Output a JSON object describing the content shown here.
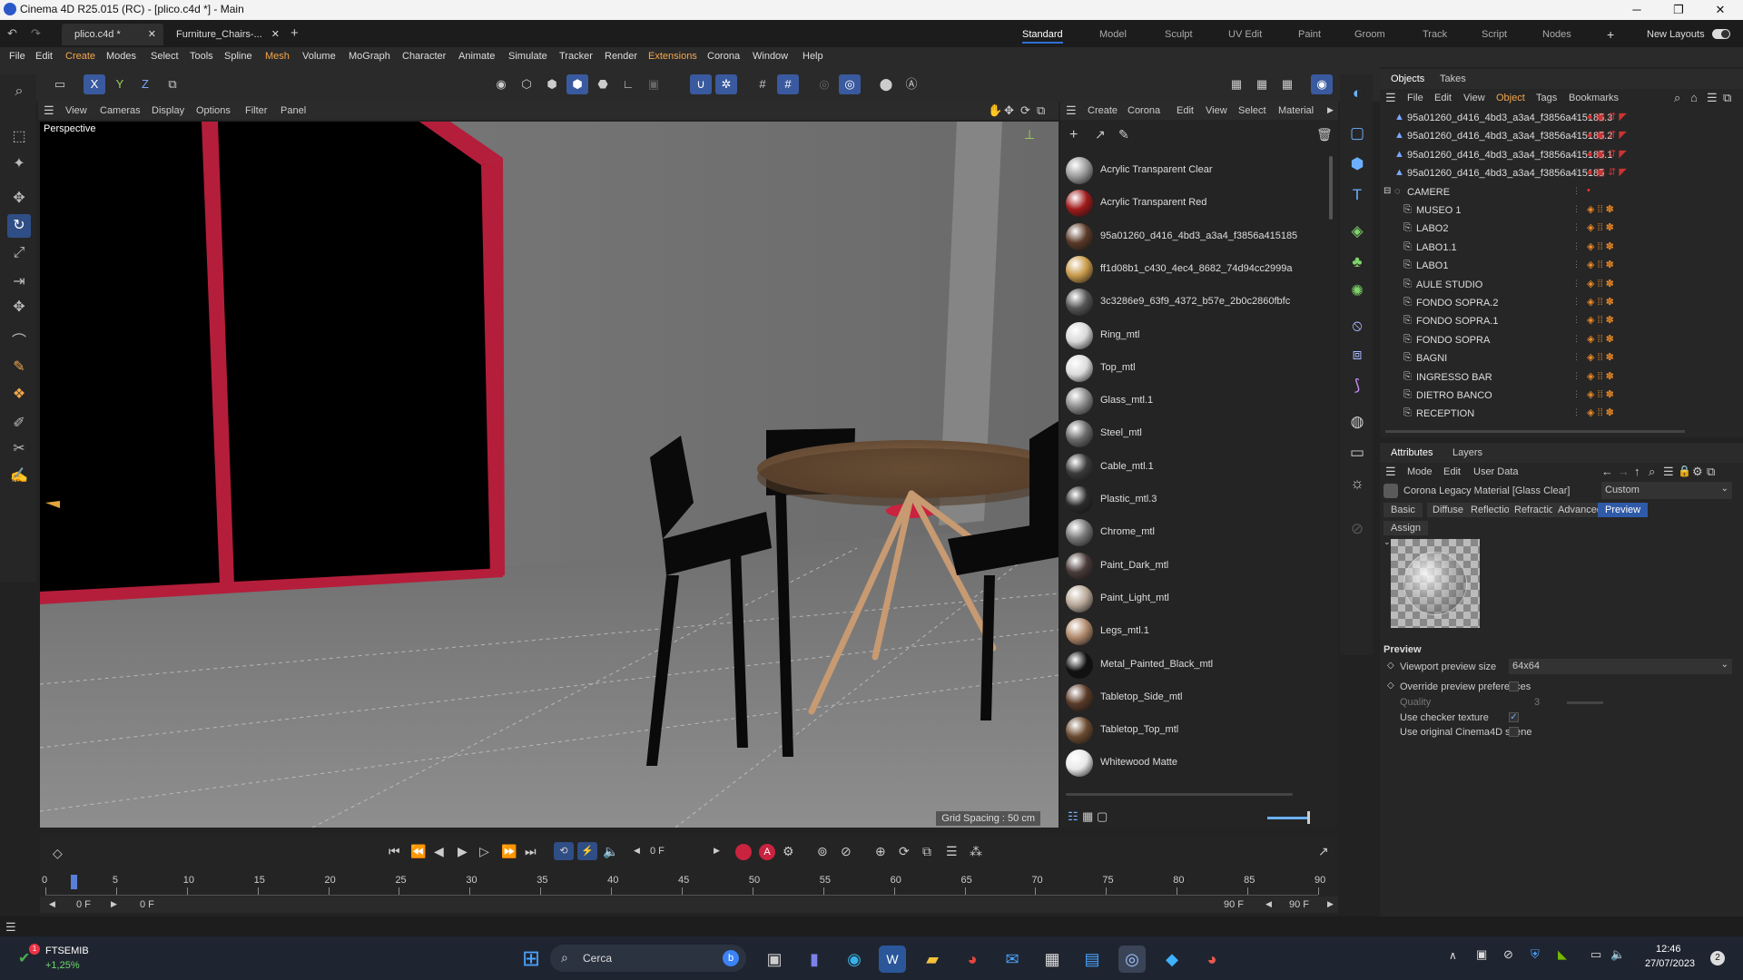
{
  "window": {
    "title": "Cinema 4D R25.015 (RC) - [plico.c4d *] - Main",
    "minimize": "─",
    "maximize": "❐",
    "close": "✕"
  },
  "doc_tabs": [
    {
      "label": "plico.c4d *",
      "close": "✕"
    },
    {
      "label": "Furniture_Chairs-...",
      "close": "✕"
    }
  ],
  "add_tab": "+",
  "layouts": [
    "Standard",
    "Model",
    "Sculpt",
    "UV Edit",
    "Paint",
    "Groom",
    "Track",
    "Script",
    "Nodes"
  ],
  "layouts_add": "+",
  "new_layouts": "New Layouts",
  "menu": [
    "File",
    "Edit",
    "Create",
    "Modes",
    "Select",
    "Tools",
    "Spline",
    "Mesh",
    "Volume",
    "MoGraph",
    "Character",
    "Animate",
    "Simulate",
    "Tracker",
    "Render",
    "Extensions",
    "Corona",
    "Window",
    "Help"
  ],
  "axis_lock": {
    "x": "X",
    "y": "Y",
    "z": "Z"
  },
  "viewport": {
    "menu": [
      "View",
      "Cameras",
      "Display",
      "Options",
      "Filter",
      "Panel"
    ],
    "label": "Perspective",
    "grid_spacing": "Grid Spacing : 50 cm"
  },
  "material_manager": {
    "menu": [
      "Create",
      "Corona",
      "Edit",
      "View",
      "Select",
      "Material"
    ],
    "materials": [
      {
        "name": "Acrylic Transparent Clear",
        "color": "#9a9a9a"
      },
      {
        "name": "Acrylic Transparent Red",
        "color": "#a01a1a"
      },
      {
        "name": "95a01260_d416_4bd3_a3a4_f3856a415185",
        "color": "#5a3a28"
      },
      {
        "name": "ff1d08b1_c430_4ec4_8682_74d94cc2999a",
        "color": "#c89a4a"
      },
      {
        "name": "3c3286e9_63f9_4372_b57e_2b0c2860fbfc",
        "color": "#555555"
      },
      {
        "name": "Ring_mtl",
        "color": "#d8d8d8"
      },
      {
        "name": "Top_mtl",
        "color": "#dcdcdc"
      },
      {
        "name": "Glass_mtl.1",
        "color": "#8a8a8a"
      },
      {
        "name": "Steel_mtl",
        "color": "#6a6a6a"
      },
      {
        "name": "Cable_mtl.1",
        "color": "#3a3a3a"
      },
      {
        "name": "Plastic_mtl.3",
        "color": "#2a2a2a"
      },
      {
        "name": "Chrome_mtl",
        "color": "#777777"
      },
      {
        "name": "Paint_Dark_mtl",
        "color": "#4a3a3a"
      },
      {
        "name": "Paint_Light_mtl",
        "color": "#b8a898"
      },
      {
        "name": "Legs_mtl.1",
        "color": "#b0886a"
      },
      {
        "name": "Metal_Painted_Black_mtl",
        "color": "#111111"
      },
      {
        "name": "Tabletop_Side_mtl",
        "color": "#5a3a28"
      },
      {
        "name": "Tabletop_Top_mtl",
        "color": "#6a4a30"
      },
      {
        "name": "Whitewood Matte",
        "color": "#e8e8e8"
      }
    ]
  },
  "objects": {
    "tabs": [
      "Objects",
      "Takes"
    ],
    "menu": [
      "File",
      "Edit",
      "View",
      "Object",
      "Tags",
      "Bookmarks"
    ],
    "items": [
      {
        "name": "95a01260_d416_4bd3_a3a4_f3856a415185.3",
        "level": 0,
        "kind": "mesh"
      },
      {
        "name": "95a01260_d416_4bd3_a3a4_f3856a415185.2",
        "level": 0,
        "kind": "mesh"
      },
      {
        "name": "95a01260_d416_4bd3_a3a4_f3856a415185.1",
        "level": 0,
        "kind": "mesh"
      },
      {
        "name": "95a01260_d416_4bd3_a3a4_f3856a415185",
        "level": 0,
        "kind": "mesh"
      },
      {
        "name": "CAMERE",
        "level": 0,
        "kind": "null"
      },
      {
        "name": "MUSEO 1",
        "level": 1,
        "kind": "camera"
      },
      {
        "name": "LABO2",
        "level": 1,
        "kind": "camera"
      },
      {
        "name": "LABO1.1",
        "level": 1,
        "kind": "camera"
      },
      {
        "name": "LABO1",
        "level": 1,
        "kind": "camera"
      },
      {
        "name": "AULE STUDIO",
        "level": 1,
        "kind": "camera"
      },
      {
        "name": "FONDO SOPRA.2",
        "level": 1,
        "kind": "camera"
      },
      {
        "name": "FONDO SOPRA.1",
        "level": 1,
        "kind": "camera"
      },
      {
        "name": "FONDO SOPRA",
        "level": 1,
        "kind": "camera"
      },
      {
        "name": "BAGNI",
        "level": 1,
        "kind": "camera"
      },
      {
        "name": "INGRESSO BAR",
        "level": 1,
        "kind": "camera"
      },
      {
        "name": "DIETRO BANCO",
        "level": 1,
        "kind": "camera"
      },
      {
        "name": "RECEPTION",
        "level": 1,
        "kind": "camera"
      },
      {
        "name": "RECEPTION",
        "level": 1,
        "kind": "camera"
      }
    ]
  },
  "attributes": {
    "tabs": [
      "Attributes",
      "Layers"
    ],
    "menu": [
      "Mode",
      "Edit",
      "User Data"
    ],
    "material_title": "Corona Legacy Material [Glass Clear]",
    "preset": "Custom",
    "subtabs": [
      "Basic",
      "Diffuse",
      "Reflection",
      "Refraction",
      "Advanced",
      "Preview"
    ],
    "assign": "Assign",
    "section": "Preview",
    "params": {
      "viewport_preview_size": {
        "label": "Viewport preview size",
        "value": "64x64"
      },
      "override": {
        "label": "Override preview preferences",
        "checked": false
      },
      "quality": {
        "label": "Quality",
        "value": "3"
      },
      "checker": {
        "label": "Use checker texture",
        "checked": true
      },
      "original_scene": {
        "label": "Use original Cinema4D scene",
        "checked": false
      }
    }
  },
  "timeline": {
    "current_frame": "0 F",
    "start": "0 F",
    "start2": "0 F",
    "end": "90 F",
    "end2": "90 F",
    "ticks": [
      "0",
      "5",
      "10",
      "15",
      "20",
      "25",
      "30",
      "35",
      "40",
      "45",
      "50",
      "55",
      "60",
      "65",
      "70",
      "75",
      "80",
      "85",
      "90"
    ],
    "playhead_frame": 2
  },
  "taskbar": {
    "stock_name": "FTSEMIB",
    "stock_change": "+1,25%",
    "stock_badge": "1",
    "search_placeholder": "Cerca",
    "time": "12:46",
    "date": "27/07/2023",
    "notifications": "2"
  }
}
